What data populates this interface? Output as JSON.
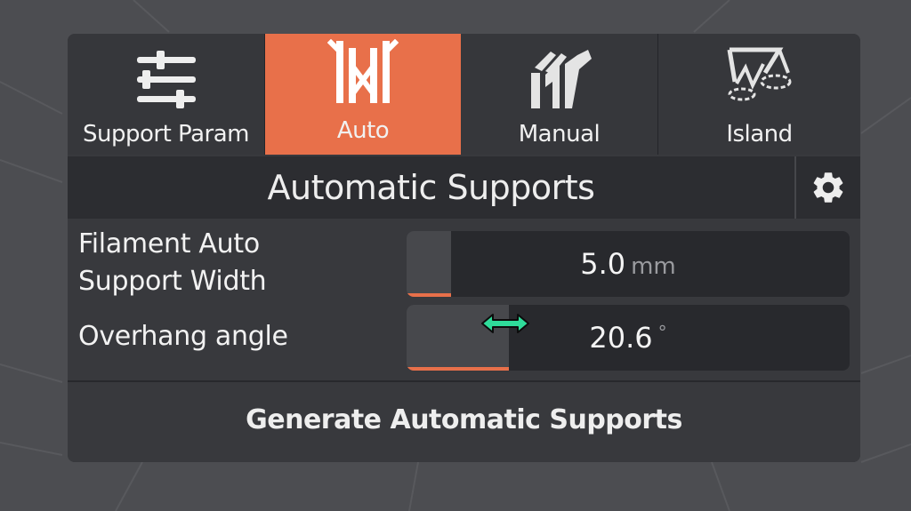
{
  "tabs": [
    {
      "label": "Support Param",
      "icon": "sliders-icon",
      "active": false
    },
    {
      "label": "Auto",
      "icon": "auto-support-icon",
      "active": true
    },
    {
      "label": "Manual",
      "icon": "manual-support-icon",
      "active": false
    },
    {
      "label": "Island",
      "icon": "island-icon",
      "active": false
    }
  ],
  "header": {
    "title": "Automatic Supports",
    "settings_icon": "gear-icon"
  },
  "fields": {
    "width": {
      "label_line1": "Filament Auto",
      "label_line2": "Support Width",
      "value": "5.0",
      "unit": "mm",
      "fill_fraction": 0.1
    },
    "angle": {
      "label": "Overhang angle",
      "value": "20.6",
      "unit": "°",
      "fill_fraction": 0.23
    }
  },
  "generate_button": {
    "label": "Generate Automatic Supports"
  },
  "colors": {
    "accent": "#e8704a",
    "panel": "#38393d",
    "header": "#2c2d31",
    "background": "#4c4d51",
    "cursor": "#2fdc9a"
  }
}
